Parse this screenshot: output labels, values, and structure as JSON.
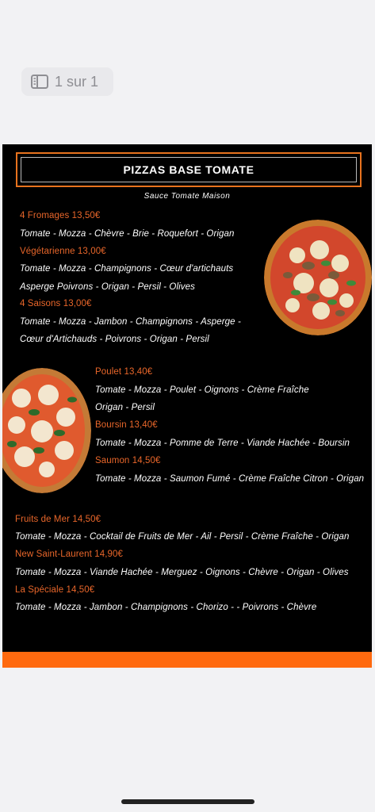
{
  "viewer": {
    "page_indicator": "1 sur 1",
    "icon": "sidebar-icon"
  },
  "menu": {
    "title": "PIZZAS BASE TOMATE",
    "subtitle": "Sauce Tomate Maison",
    "colors": {
      "background": "#000000",
      "accent": "#e8731e",
      "name": "#e8662a",
      "text": "#ffffff",
      "footer": "#ff6a0f"
    },
    "group1": [
      {
        "name": "4 Fromages 13,50€",
        "lines": [
          "Tomate -  Mozza - Chèvre - Brie - Roquefort - Origan"
        ]
      },
      {
        "name": "Végétarienne 13,00€",
        "lines": [
          "Tomate -  Mozza - Champignons - Cœur d'artichauts",
          "Asperge Poivrons - Origan - Persil - Olives"
        ]
      },
      {
        "name": "4 Saisons 13,00€",
        "lines": [
          "Tomate - Mozza - Jambon -  Champignons - Asperge -",
          "Cœur d'Artichauds - Poivrons - Origan - Persil"
        ]
      }
    ],
    "group2": [
      {
        "name": "Poulet 13,40€",
        "lines": [
          "Tomate -  Mozza - Poulet - Oignons - Crème Fraîche",
          "Origan - Persil"
        ]
      },
      {
        "name": "Boursin 13,40€",
        "lines": [
          "Tomate -  Mozza - Pomme de Terre - Viande Hachée - Boursin"
        ]
      },
      {
        "name": "Saumon 14,50€",
        "lines": [
          "Tomate - Mozza - Saumon Fumé - Crème Fraîche Citron - Origan"
        ]
      }
    ],
    "group3": [
      {
        "name": "Fruits de Mer 14,50€",
        "lines": [
          "Tomate - Mozza - Cocktail de Fruits de Mer - Ail - Persil  - Crème Fraîche - Origan"
        ]
      },
      {
        "name": "New Saint-Laurent 14,90€",
        "lines": [
          "Tomate -  Mozza - Viande Hachée - Merguez - Oignons  - Chèvre - Origan - Olives"
        ]
      },
      {
        "name": "La Spéciale 14,50€",
        "lines": [
          "Tomate - Mozza - Jambon - Champignons - Chorizo -  - Poivrons - Chèvre"
        ]
      }
    ]
  }
}
